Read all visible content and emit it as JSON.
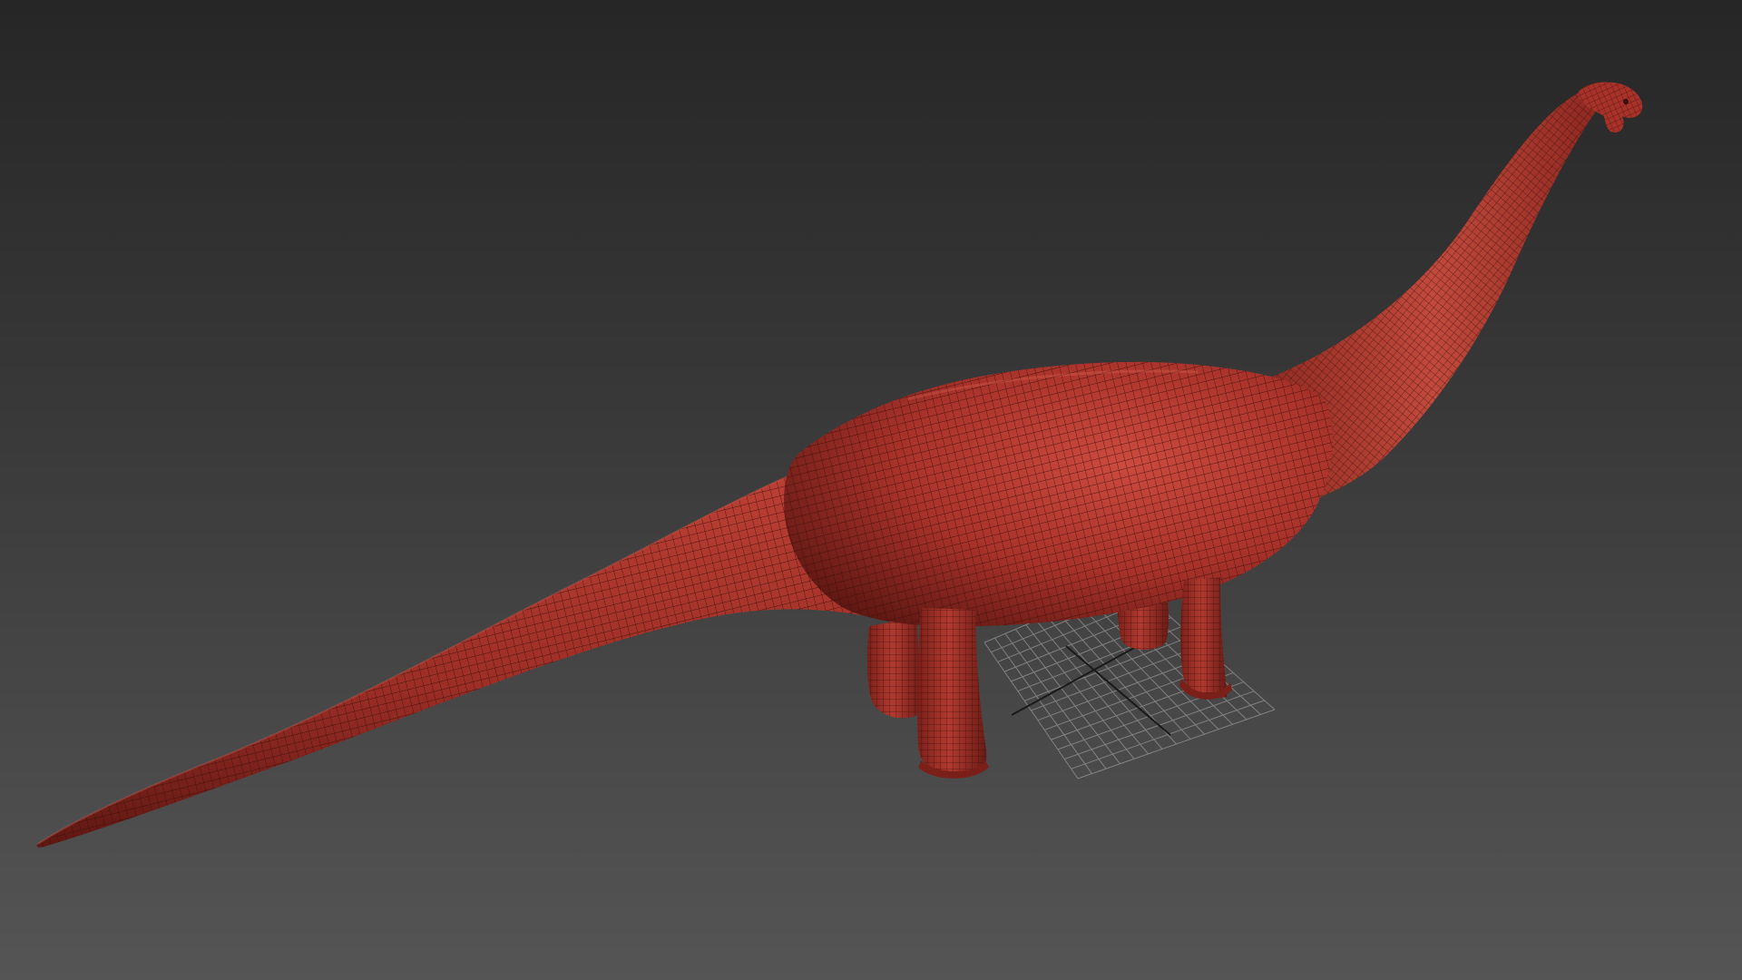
{
  "viewport": {
    "background_top": "#262626",
    "background_bottom": "#555555",
    "grid_color": "#a8a8a8",
    "grid_axis_color": "#1a1a1a"
  },
  "model": {
    "base_color": "#a8322a",
    "highlight_color": "#cc4a3e",
    "shadow_color": "#5e1712",
    "wire_color": "#3a0f0c"
  }
}
